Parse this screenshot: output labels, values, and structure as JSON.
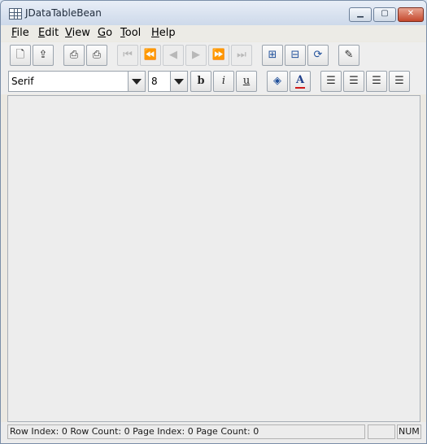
{
  "window": {
    "title": "JDataTableBean"
  },
  "menu": [
    {
      "mnemonic": "F",
      "rest": "ile"
    },
    {
      "mnemonic": "E",
      "rest": "dit"
    },
    {
      "mnemonic": "V",
      "rest": "iew"
    },
    {
      "mnemonic": "G",
      "rest": "o"
    },
    {
      "mnemonic": "T",
      "rest": "ool"
    },
    {
      "mnemonic": "H",
      "rest": "elp"
    }
  ],
  "toolbar": {
    "icons": {
      "new": "new-document-icon",
      "open": "open-icon",
      "print": "print-icon",
      "print_preview": "print-preview-icon",
      "first": "first-icon",
      "prev_page": "previous-page-icon",
      "prev": "previous-icon",
      "next": "next-icon",
      "next_page": "next-page-icon",
      "last": "last-icon",
      "insert_row": "insert-row-icon",
      "delete_row": "delete-row-icon",
      "refresh": "refresh-icon",
      "export": "export-icon"
    }
  },
  "format": {
    "font_name": "Serif",
    "font_size": "8",
    "bold": "b",
    "italic": "i",
    "underline": "u",
    "font_color_glyph": "A"
  },
  "status": {
    "text": "Row Index: 0 Row Count: 0 Page Index: 0 Page Count: 0",
    "num": "NUM"
  }
}
